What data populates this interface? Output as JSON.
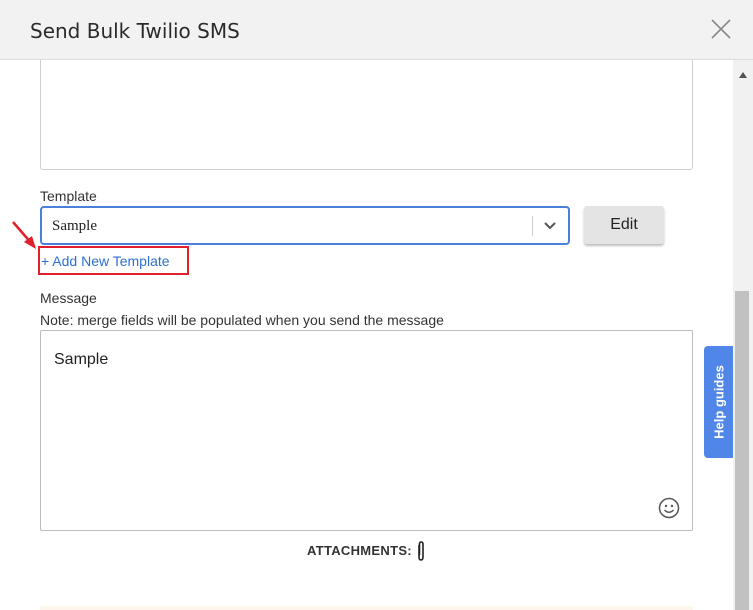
{
  "dialog": {
    "title": "Send Bulk Twilio SMS",
    "close_icon": "close-icon"
  },
  "template": {
    "label": "Template",
    "selected": "Sample",
    "edit_label": "Edit",
    "add_new_label": "+ Add New Template"
  },
  "message": {
    "label": "Message",
    "note": "Note: merge fields will be populated when you send the message",
    "value": "Sample"
  },
  "attachments": {
    "label": "ATTACHMENTS:"
  },
  "help": {
    "label": "Help guides"
  },
  "colors": {
    "accent": "#4f86e8",
    "highlight": "#e0202a",
    "link": "#2f6fd0"
  }
}
